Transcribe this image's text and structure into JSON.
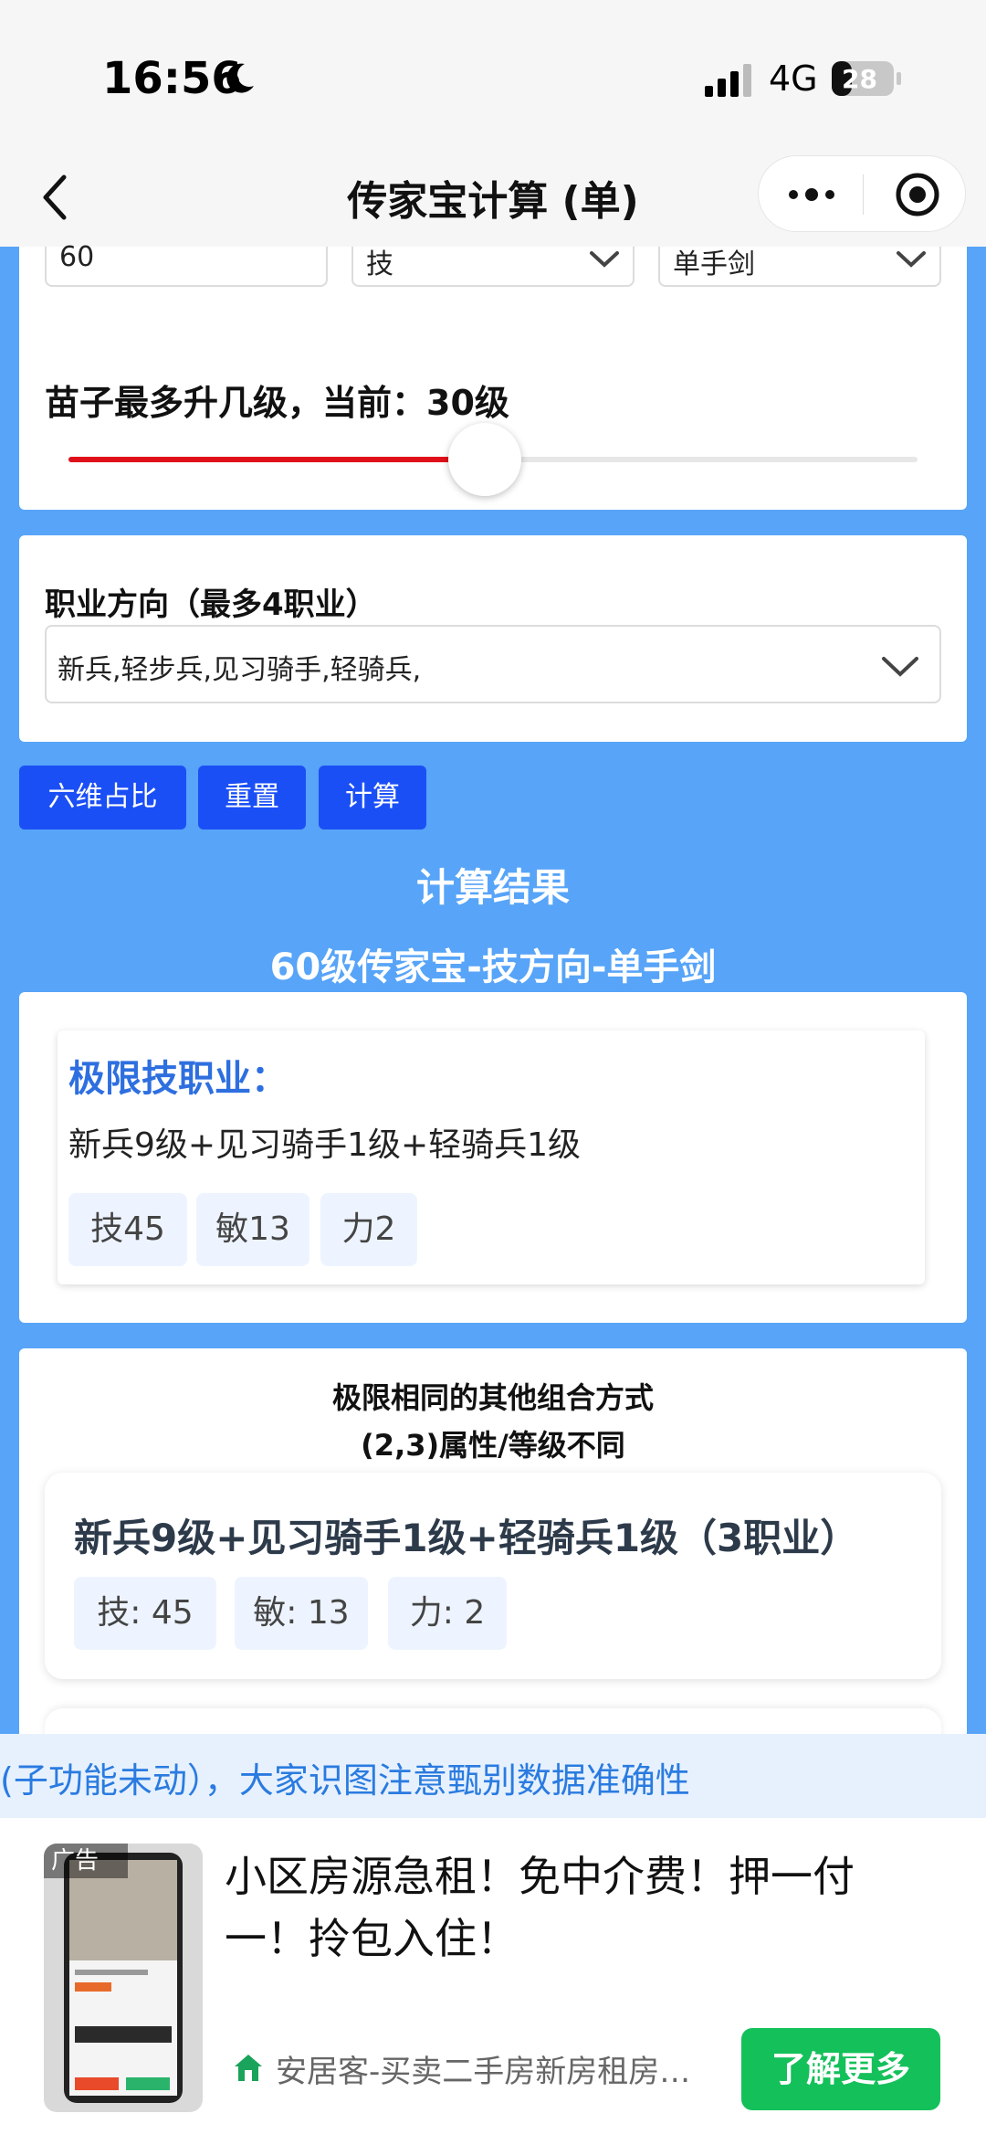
{
  "status_bar": {
    "time": "16:56",
    "network": "4G",
    "battery": "28"
  },
  "nav": {
    "title": "传家宝计算 (单)"
  },
  "selects": {
    "level": "60",
    "direction": "技",
    "weapon": "单手剑"
  },
  "slider": {
    "label": "苗子最多升几级，当前：30级",
    "value_fraction": 0.49
  },
  "job": {
    "label": "职业方向（最多4职业）",
    "value": "新兵,轻步兵,见习骑手,轻骑兵,"
  },
  "buttons": {
    "ratio": "六维占比",
    "reset": "重置",
    "calculate": "计算"
  },
  "results": {
    "title": "计算结果",
    "subtitle": "60级传家宝-技方向-单手剑",
    "limit": {
      "title": "极限技职业：",
      "combo": "新兵9级+见习骑手1级+轻骑兵1级",
      "tags": [
        "技45",
        "敏13",
        "力2"
      ]
    },
    "other": {
      "title_line1": "极限相同的其他组合方式",
      "title_line2": "(2,3)属性/等级不同",
      "combo": "新兵9级+见习骑手1级+轻骑兵1级（3职业）",
      "tags": [
        "技: 45",
        "敏: 13",
        "力: 2"
      ]
    }
  },
  "ticker": {
    "text": "(子功能未动），大家识图注意甄别数据准确性"
  },
  "ad": {
    "badge": "广告",
    "text": "小区房源急租！免中介费！押一付一！拎包入住！",
    "source": "安居客-买卖二手房新房租房…",
    "cta": "了解更多"
  },
  "colors": {
    "background": "#57a4f8",
    "button": "#1b4ff6",
    "slider_fill": "#e0101a",
    "cta": "#14c05a"
  }
}
